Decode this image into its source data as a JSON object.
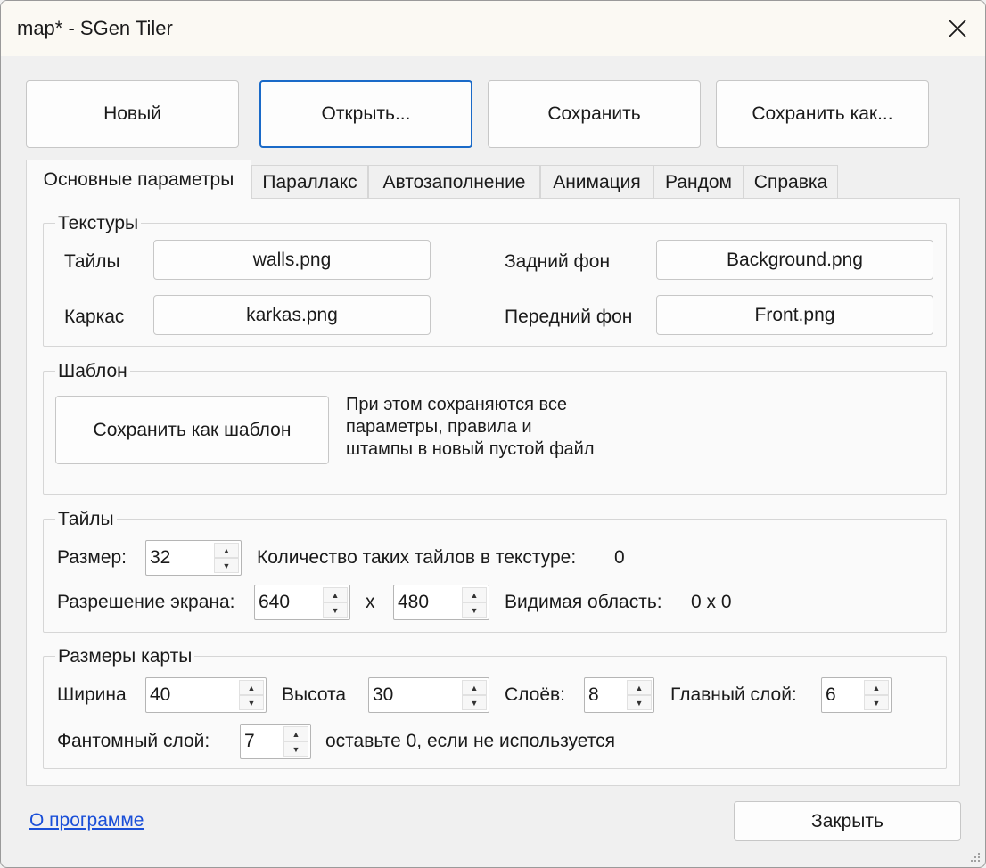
{
  "window": {
    "title": "map* - SGen Tiler"
  },
  "toolbar": {
    "new_label": "Новый",
    "open_label": "Открыть...",
    "save_label": "Сохранить",
    "save_as_label": "Сохранить как..."
  },
  "tabs": [
    {
      "label": "Основные параметры",
      "active": true
    },
    {
      "label": "Параллакс"
    },
    {
      "label": "Автозаполнение"
    },
    {
      "label": "Анимация"
    },
    {
      "label": "Рандом"
    },
    {
      "label": "Справка"
    }
  ],
  "textures": {
    "group_label": "Текстуры",
    "tiles_label": "Тайлы",
    "tiles_file": "walls.png",
    "karkas_label": "Каркас",
    "karkas_file": "karkas.png",
    "back_label": "Задний фон",
    "back_file": "Background.png",
    "front_label": "Передний фон",
    "front_file": "Front.png"
  },
  "template": {
    "group_label": "Шаблон",
    "save_button": "Сохранить как шаблон",
    "description": [
      "При этом сохраняются все",
      "параметры, правила и",
      "штампы в новый пустой файл"
    ]
  },
  "tiles": {
    "group_label": "Тайлы",
    "size_label": "Размер:",
    "size_value": "32",
    "count_label": "Количество таких тайлов в текстуре:",
    "count_value": "0",
    "resolution_label": "Разрешение экрана:",
    "res_w": "640",
    "res_x": "x",
    "res_h": "480",
    "visible_label": "Видимая область:",
    "visible_value": "0 x 0"
  },
  "map_size": {
    "group_label": "Размеры карты",
    "width_label": "Ширина",
    "width_value": "40",
    "height_label": "Высота",
    "height_value": "30",
    "layers_label": "Слоёв:",
    "layers_value": "8",
    "main_layer_label": "Главный слой:",
    "main_layer_value": "6",
    "phantom_label": "Фантомный слой:",
    "phantom_value": "7",
    "phantom_hint": "оставьте 0, если не используется"
  },
  "footer": {
    "about_link": "О программе",
    "close_button": "Закрыть"
  }
}
